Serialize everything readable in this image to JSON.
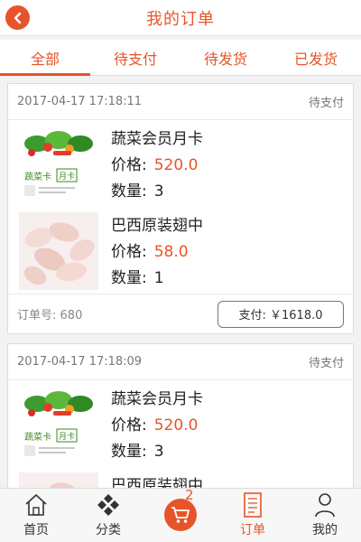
{
  "header": {
    "title": "我的订单",
    "back_icon": "chevron-left-icon"
  },
  "tabs": [
    {
      "label": "全部",
      "active": true
    },
    {
      "label": "待支付",
      "active": false
    },
    {
      "label": "待发货",
      "active": false
    },
    {
      "label": "已发货",
      "active": false
    }
  ],
  "labels": {
    "price": "价格:",
    "quantity": "数量:",
    "order_no": "订单号:"
  },
  "orders": [
    {
      "time": "2017-04-17 17:18:11",
      "status": "待支付",
      "products": [
        {
          "name": "蔬菜会员月卡",
          "price": "520.0",
          "quantity": "3",
          "image": "vegetable-card-image"
        },
        {
          "name": "巴西原装翅中",
          "price": "58.0",
          "quantity": "1",
          "image": "chicken-wings-image"
        }
      ],
      "order_no": "680",
      "pay_label": "支付: ￥1618.0"
    },
    {
      "time": "2017-04-17 17:18:09",
      "status": "待支付",
      "products": [
        {
          "name": "蔬菜会员月卡",
          "price": "520.0",
          "quantity": "3",
          "image": "vegetable-card-image"
        },
        {
          "name": "巴西原装翅中",
          "price": "",
          "quantity": "",
          "image": "chicken-wings-image"
        }
      ]
    }
  ],
  "card_image_text": {
    "brand": "蔬菜卡",
    "tag": "月卡"
  },
  "bottom_nav": [
    {
      "label": "首页",
      "icon": "home-icon",
      "active": false
    },
    {
      "label": "分类",
      "icon": "category-icon",
      "active": false
    },
    {
      "label": "",
      "icon": "cart-icon",
      "active": false,
      "badge": "2"
    },
    {
      "label": "订单",
      "icon": "order-icon",
      "active": true
    },
    {
      "label": "我的",
      "icon": "user-icon",
      "active": false
    }
  ],
  "colors": {
    "accent": "#e8542a",
    "background": "#f2f2f2",
    "text": "#222222"
  }
}
